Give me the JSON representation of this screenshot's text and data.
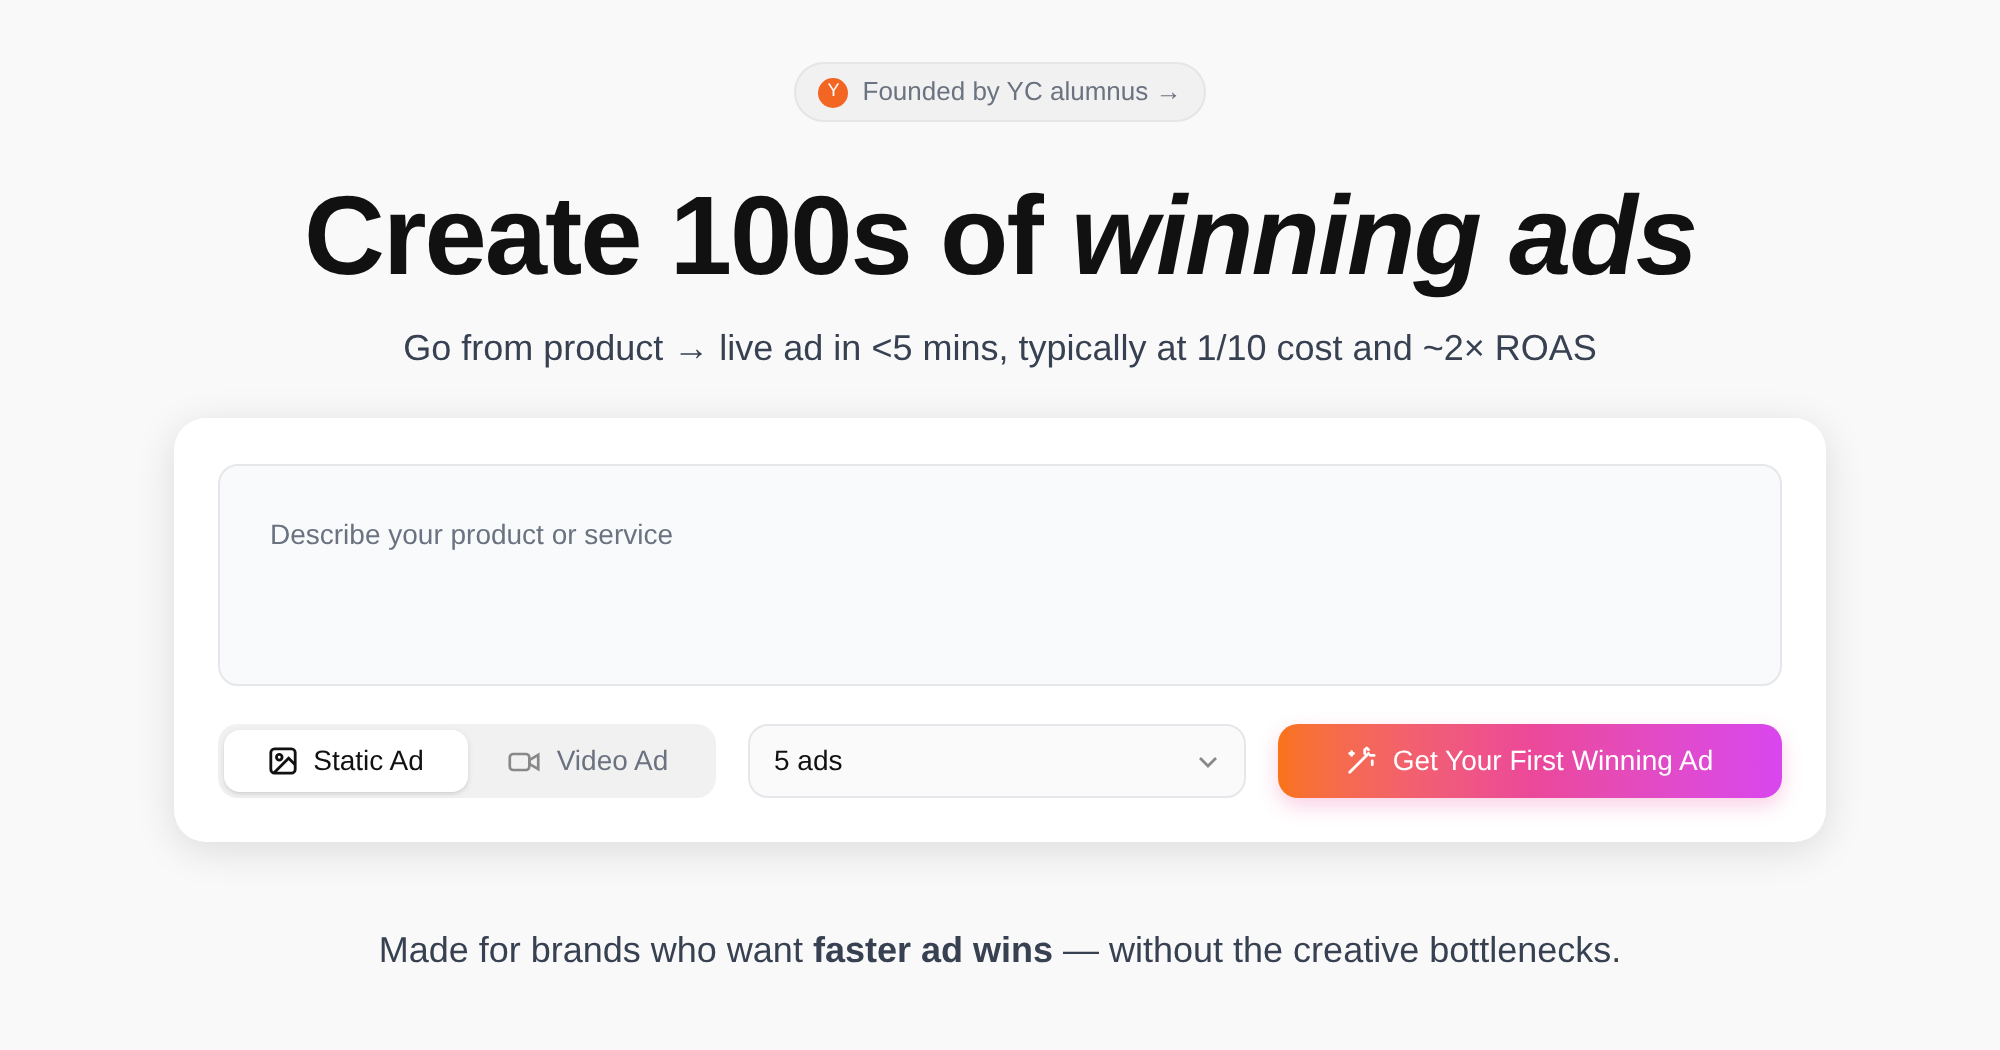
{
  "badge": {
    "logo": "Y",
    "label": "Founded by YC alumnus →"
  },
  "headline": "Create 100s of *winning ads*",
  "subtitle": "Go from product → live ad in <5 mins, typically at 1/10 cost and ~2× ROAS",
  "form": {
    "description": {
      "placeholder": "Describe your product or service"
    },
    "ad_types": [
      {
        "label": "Static Ad",
        "kind": "image",
        "selected": true
      },
      {
        "label": "Video Ad",
        "kind": "video",
        "selected": false
      }
    ],
    "count_select": {
      "value": "5 ads"
    },
    "submit": "Get Your First Winning Ad"
  },
  "tagline": "Made for brands who want **faster ad wins** — without the creative bottlenecks."
}
